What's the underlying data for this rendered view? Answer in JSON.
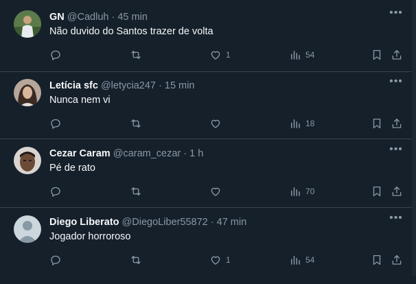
{
  "tweets": [
    {
      "name": "GN",
      "handle": "@Cadluh",
      "time": "45 min",
      "text": "Não duvido do Santos trazer de volta",
      "likes": "1",
      "views": "54",
      "replies": "",
      "retweets": ""
    },
    {
      "name": "Letícia sfc",
      "handle": "@letycia247",
      "time": "15 min",
      "text": "Nunca nem vi",
      "likes": "",
      "views": "18",
      "replies": "",
      "retweets": ""
    },
    {
      "name": "Cezar Caram",
      "handle": "@caram_cezar",
      "time": "1 h",
      "text": "Pé de rato",
      "likes": "",
      "views": "70",
      "replies": "",
      "retweets": ""
    },
    {
      "name": "Diego Liberato",
      "handle": "@DiegoLiber55872",
      "time": "47 min",
      "text": "Jogador horroroso",
      "likes": "1",
      "views": "54",
      "replies": "",
      "retweets": ""
    }
  ],
  "separator": "·",
  "more_label": "•••",
  "icons": {
    "reply": "reply-icon",
    "retweet": "retweet-icon",
    "like": "heart-icon",
    "views": "views-icon",
    "bookmark": "bookmark-icon",
    "share": "share-icon",
    "more": "more-icon"
  },
  "colors": {
    "background": "#15202b",
    "divider": "#38444d",
    "text": "#f7f9f9",
    "secondary": "#8b98a5"
  }
}
